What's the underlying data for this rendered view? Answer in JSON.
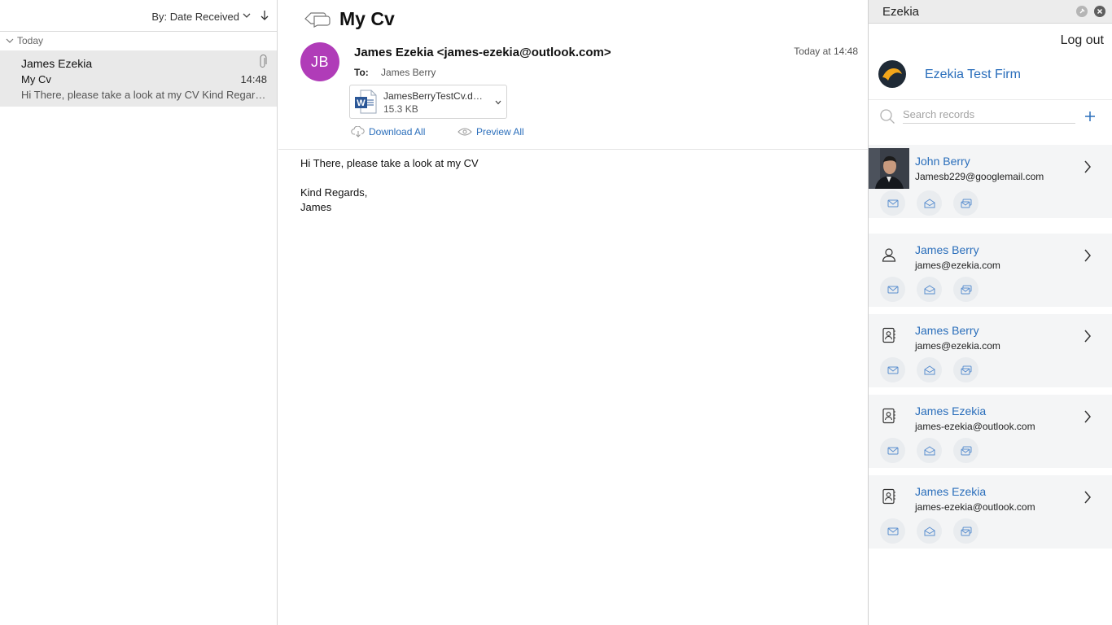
{
  "message_list": {
    "sort_label": "By: Date Received",
    "group_label": "Today",
    "items": [
      {
        "sender": "James Ezekia",
        "subject": "My Cv",
        "time": "14:48",
        "preview": "Hi There, please take a look at my CV Kind Regards, James"
      }
    ]
  },
  "reading_pane": {
    "subject": "My Cv",
    "avatar_initials": "JB",
    "avatar_color": "#b03cb8",
    "from": "James Ezekia <james-ezekia@outlook.com>",
    "received": "Today at 14:48",
    "to_label": "To:",
    "to": "James Berry",
    "attachment": {
      "name": "JamesBerryTestCv.docx",
      "size": "15.3 KB",
      "icon": "word-icon"
    },
    "download_all_label": "Download All",
    "preview_all_label": "Preview All",
    "body_lines": [
      "Hi There, please take a look at my CV",
      "Kind Regards,",
      "James"
    ]
  },
  "ezekia": {
    "title": "Ezekia",
    "logout_label": "Log out",
    "firm_name": "Ezekia Test Firm",
    "search_placeholder": "Search records",
    "accent_color": "#2a6ebb",
    "records": [
      {
        "name": "John Berry",
        "email": "Jamesb229@googlemail.com",
        "icon": "photo"
      },
      {
        "name": "James Berry",
        "email": "james@ezekia.com",
        "icon": "person-icon"
      },
      {
        "name": "James Berry",
        "email": "james@ezekia.com",
        "icon": "contact-card-icon"
      },
      {
        "name": "James Ezekia",
        "email": "james-ezekia@outlook.com",
        "icon": "contact-card-icon"
      },
      {
        "name": "James Ezekia",
        "email": "james-ezekia@outlook.com",
        "icon": "contact-card-icon"
      }
    ]
  }
}
